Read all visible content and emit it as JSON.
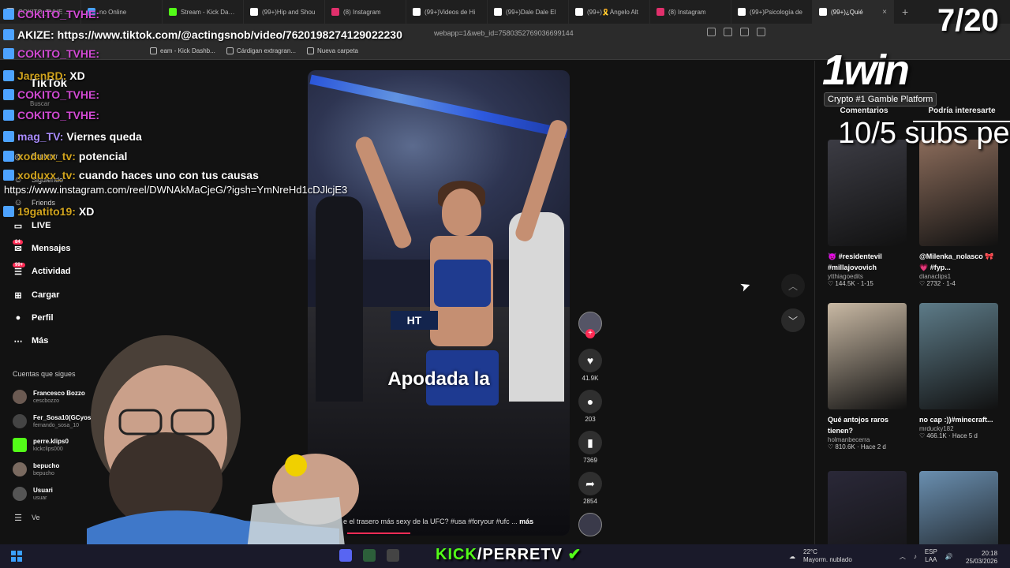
{
  "browser": {
    "tabs": [
      {
        "label": "COKITO_TVHE ...",
        "color": "#b0b0b0"
      },
      {
        "label": "no Online",
        "color": "#4aa3ff"
      },
      {
        "label": "Stream - Kick Dashb",
        "color": "#53fc18"
      },
      {
        "label": "(99+)Hip and Shou",
        "color": "#ffffff"
      },
      {
        "label": "(8) Instagram",
        "color": "#e1306c"
      },
      {
        "label": "(99+)Videos de Hi",
        "color": "#ffffff"
      },
      {
        "label": "(99+)Dale Dale El",
        "color": "#ffffff"
      },
      {
        "label": "(99+)🎗️Ángelo Alt",
        "color": "#ffffff"
      },
      {
        "label": "(8) Instagram",
        "color": "#e1306c"
      },
      {
        "label": "(99+)Psicología de",
        "color": "#ffffff"
      },
      {
        "label": "(99+)¿Quié",
        "color": "#ffffff",
        "active": true
      }
    ],
    "url_visible": "webapp=1&web_id=7580352769036699144",
    "bookmarks": [
      "eam - Kick Dashb...",
      "Cárdigan extragran...",
      "Nueva carpeta"
    ]
  },
  "sidebar": {
    "logo": "TikTok",
    "search_placeholder": "Buscar",
    "nav": [
      {
        "label": "Explorar",
        "small": true
      },
      {
        "label": "Siguiendo",
        "small": true
      },
      {
        "label": "Friends",
        "small": true
      },
      {
        "label": "LIVE",
        "icon": "▭"
      },
      {
        "label": "Mensajes",
        "icon": "✉",
        "badge": "84"
      },
      {
        "label": "Actividad",
        "icon": "☰",
        "badge": "99+"
      },
      {
        "label": "Cargar",
        "icon": "⊞"
      },
      {
        "label": "Perfil",
        "icon": "●"
      },
      {
        "label": "Más",
        "icon": "⋯"
      }
    ],
    "following_title": "Cuentas que sigues",
    "following": [
      {
        "name": "Francesco Bozzo",
        "handle": "cescbozzo"
      },
      {
        "name": "Fer_Sosa10(GCyoso",
        "handle": "fernando_sosa_10"
      },
      {
        "name": "perre.klips0",
        "handle": "kickclips000"
      },
      {
        "name": "bepucho",
        "handle": "bepucho"
      },
      {
        "name": "Usuari",
        "handle": "usuar"
      }
    ],
    "see_more": "Ve"
  },
  "video": {
    "overlay_text": "Apodada la",
    "ufc_banner": "HT",
    "description": "e el trasero más sexy de la UFC? #usa #foryour #ufc ...",
    "more_label": "más",
    "progress": 0.24
  },
  "actions": {
    "like_count": "41.9K",
    "comment_count": "203",
    "save_count": "7369",
    "share_count": "2854"
  },
  "right_panel": {
    "tabs": [
      "Comentarios",
      "Podría interesarte"
    ],
    "cards": [
      {
        "title": "😈 #residentevil #millajovovich",
        "user": "ytthiagoedits",
        "meta": "♡ 144.5K · 1-15",
        "bg": "#3c3c44"
      },
      {
        "title": "@Milenka_nolasco 🎀💗 #fyp...",
        "user": "dianaclips1",
        "meta": "♡ 2732 · 1-4",
        "bg": "#8a6b5a"
      },
      {
        "title": "Qué antojos raros tienen?",
        "user": "holmanbecerra",
        "meta": "♡ 810.6K · Hace 2 d",
        "bg": "#c9b9a4"
      },
      {
        "title": "no cap :))#minecraft...",
        "user": "mrducky182",
        "meta": "♡ 466.1K · Hace 5 d",
        "bg": "#5d7b88"
      },
      {
        "title": "",
        "user": "",
        "meta": "",
        "bg": "#2a2838"
      },
      {
        "title": "",
        "user": "",
        "meta": "",
        "bg": "#6a8fb0"
      }
    ]
  },
  "stream": {
    "chat": [
      {
        "name": "COKITO_TVHE:",
        "msg": "",
        "color": "#d14ad3"
      },
      {
        "name": "AKIZE:",
        "msg": "https://www.tiktok.com/@actingsnob/video/7620198274129022230",
        "color": "#ffffff"
      },
      {
        "name": "COKITO_TVHE:",
        "msg": "",
        "color": "#d14ad3"
      },
      {
        "name": "JarenRD:",
        "msg": "XD",
        "color": "#d0a31d"
      },
      {
        "name": "COKITO_TVHE:",
        "msg": "",
        "color": "#d14ad3"
      },
      {
        "name": "COKITO_TVHE:",
        "msg": "",
        "color": "#d14ad3"
      },
      {
        "name": "mag_TV:",
        "msg": "Viernes queda",
        "color": "#a98cff"
      },
      {
        "name": "xoduxx_tv:",
        "msg": "potencial",
        "color": "#d0a31d"
      },
      {
        "name": "xoduxx_tv:",
        "msg": "cuando haces uno con tus causas",
        "color": "#d0a31d"
      },
      {
        "name": "19gatito19:",
        "msg": "XD",
        "color": "#d0a31d"
      }
    ],
    "instagram_url": "https://www.instagram.com/reel/DWNAkMaCjeG/?igsh=YmNreHd1cDJlcjE3",
    "counter_top": "7/20",
    "counter_subs": "10/5 subs pe",
    "sponsor_logo": "1win",
    "sponsor_tag": "Crypto #1 Gamble Platform",
    "kick_prefix": "KICK",
    "kick_handle": "/PERRETV"
  },
  "taskbar": {
    "weather_temp": "22°C",
    "weather_desc": "Mayorm. nublado",
    "lang_1": "ESP",
    "lang_2": "LAA",
    "time": "20:18",
    "date": "25/03/2026"
  }
}
